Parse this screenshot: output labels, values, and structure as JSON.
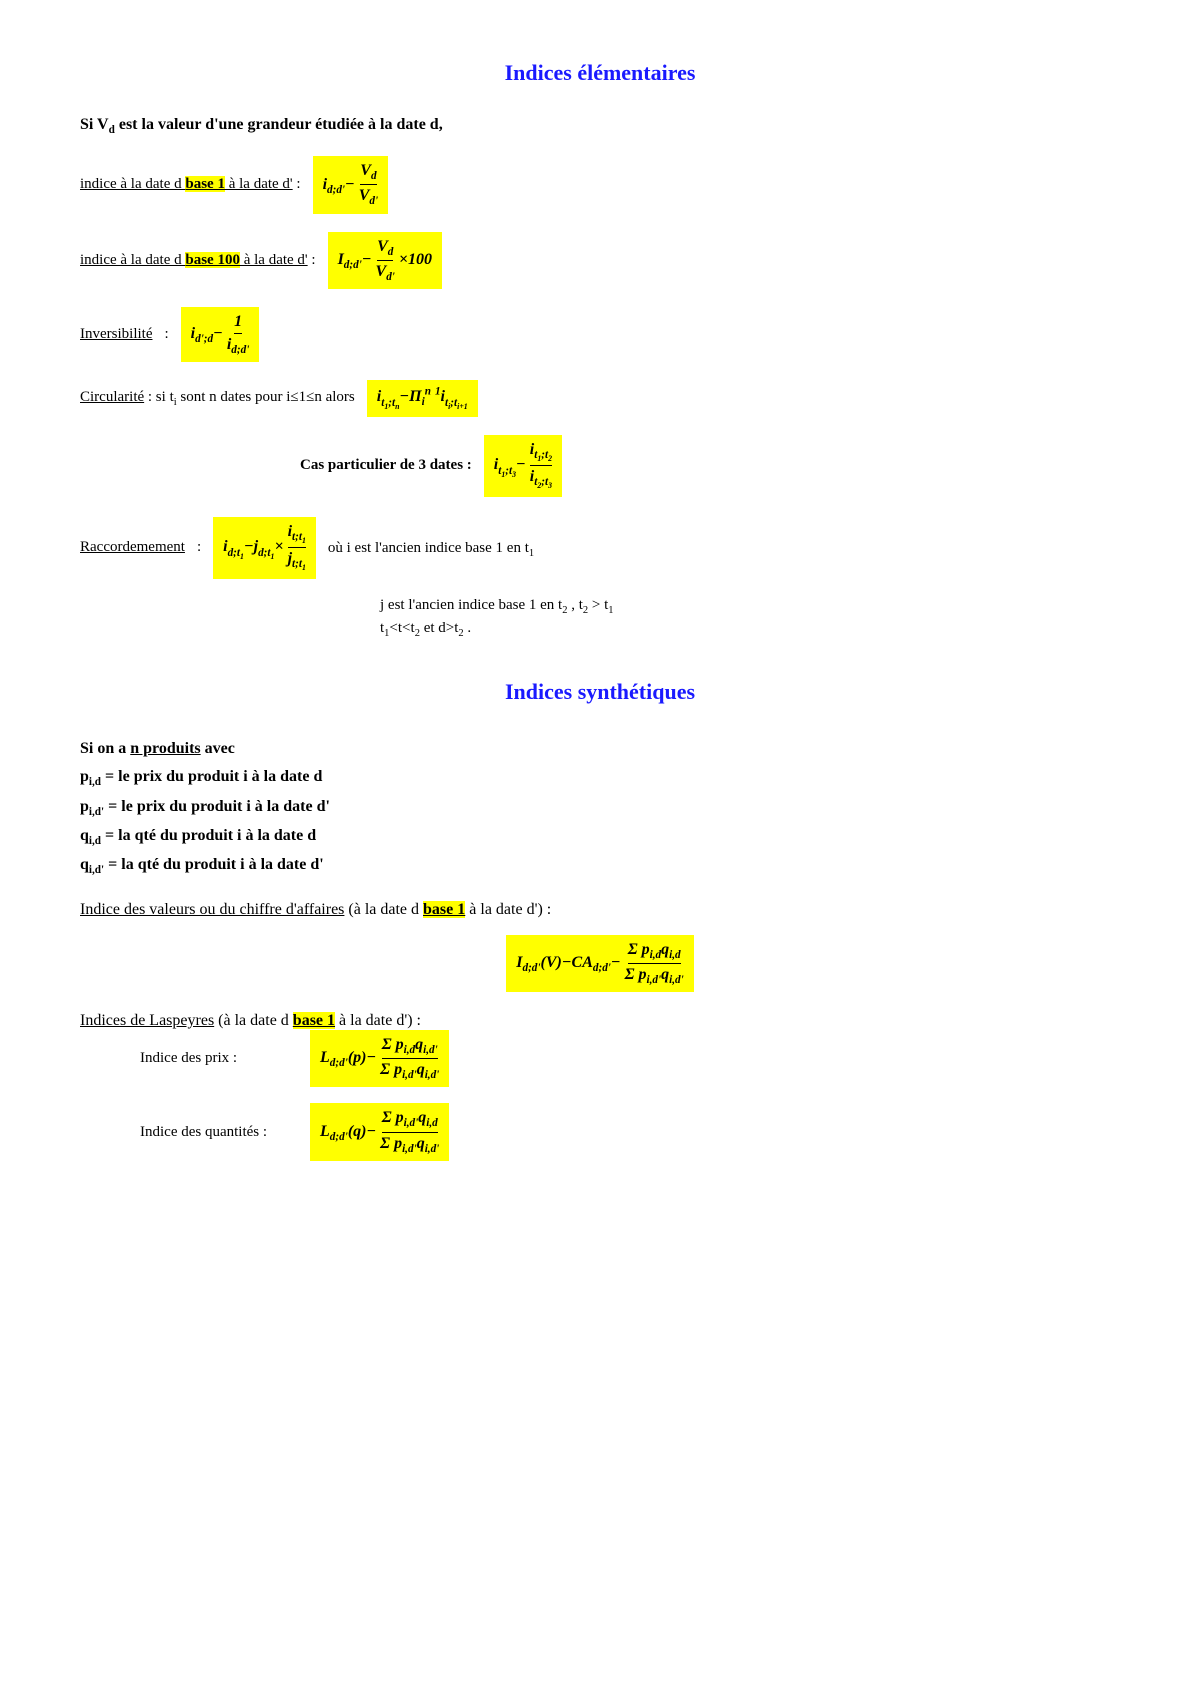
{
  "page": {
    "section1_title": "Indices élémentaires",
    "section2_title": "Indices synthétiques",
    "intro1": "Si V",
    "intro1_sub": "d",
    "intro1_cont": " est la valeur d'une grandeur étudiée à la date d,",
    "line1_label": "indice à la date d ",
    "line1_base": "base 1",
    "line1_cont": " à la date d' : ",
    "line2_label": "indice à la date d ",
    "line2_base": "base 100",
    "line2_cont": " à la date d' : ",
    "inversibility_label": "Inversibilité : ",
    "circularity_label": "Circularité : si t",
    "circularity_i": "i",
    "circularity_cont": " sont n dates pour i≤1≤n alors",
    "cas_particulier": "Cas particulier de 3 dates : ",
    "raccord_label": "Raccordemement : ",
    "raccord_note1": "où   i est l'ancien indice base 1 en t",
    "raccord_note1_sub": "1",
    "raccord_note2": "j est l'ancien indice base 1 en t",
    "raccord_note2_sub2": "2",
    "raccord_note2_cont": " , t",
    "raccord_note2_sub3": "2",
    "raccord_note2_cont2": " > t",
    "raccord_note2_sub4": "1",
    "raccord_note3": "t",
    "raccord_note3_sub1": "1",
    "raccord_note3_cont": "<t<t",
    "raccord_note3_sub2": "2",
    "raccord_note3_cont2": " et d>t",
    "raccord_note3_sub3": "2",
    "raccord_note3_cont3": ".",
    "synth_intro1": "Si on a ",
    "synth_intro1_u": "n produits",
    "synth_intro1_cont": " avec",
    "synth_p1": "p",
    "synth_p1_sub": "i,d",
    "synth_p1_cont": " = le prix du produit i à la date d",
    "synth_p2": "p",
    "synth_p2_sub": "i,d'",
    "synth_p2_cont": " = le prix du produit i à la date d'",
    "synth_q1": "q",
    "synth_q1_sub": "i,d",
    "synth_q1_cont": " = la qté du produit i à la date d",
    "synth_q2": "q",
    "synth_q2_sub": "i,d'",
    "synth_q2_cont": " = la qté du produit i à la date d'",
    "indice_valeurs_label": "Indice des valeurs ou du chiffre d'affaires",
    "indice_valeurs_mid": " (à la date d ",
    "indice_valeurs_base": "base 1",
    "indice_valeurs_cont": " à la date d') : ",
    "laspeyres_label": "Indices de Laspeyres",
    "laspeyres_mid": " (à la date d ",
    "laspeyres_base": "base 1",
    "laspeyres_cont": " à la date d') : ",
    "indice_prix_label": "Indice des prix : ",
    "indice_qte_label": "Indice des quantités : "
  }
}
